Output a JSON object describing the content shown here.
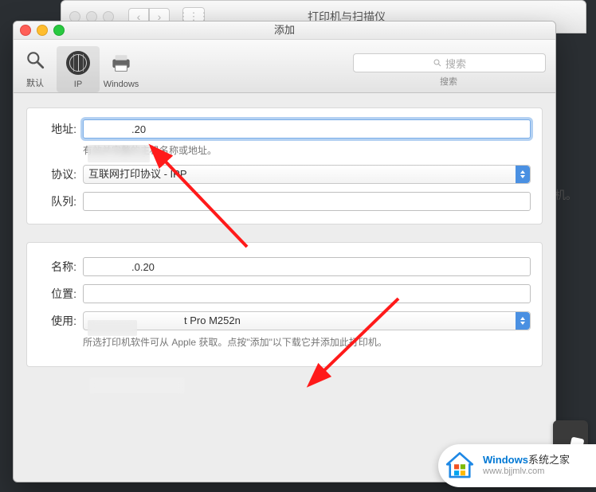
{
  "parent_window": {
    "title": "打印机与扫描仪"
  },
  "add_window": {
    "title": "添加",
    "tabs": {
      "default": "默认",
      "ip": "IP",
      "windows": "Windows"
    },
    "search": {
      "placeholder": "搜索",
      "caption": "搜索"
    },
    "fields": {
      "address_label": "地址:",
      "address_value": ".20",
      "address_help": "有效并完整的主机名称或地址。",
      "protocol_label": "协议:",
      "protocol_value": "互联网打印协议 - IPP",
      "queue_label": "队列:",
      "queue_value": "",
      "name_label": "名称:",
      "name_value": ".0.20",
      "location_label": "位置:",
      "location_value": "",
      "use_label": "使用:",
      "use_value": "t Pro M252n",
      "use_help": "所选打印机软件可从 Apple 获取。点按\"添加\"以下载它并添加此打印机。"
    }
  },
  "bg_hint": "丁印机。",
  "watermark": {
    "line1_prefix": "Windows",
    "line1_suffix": "系统之家",
    "line2": "www.bjjmlv.com"
  }
}
